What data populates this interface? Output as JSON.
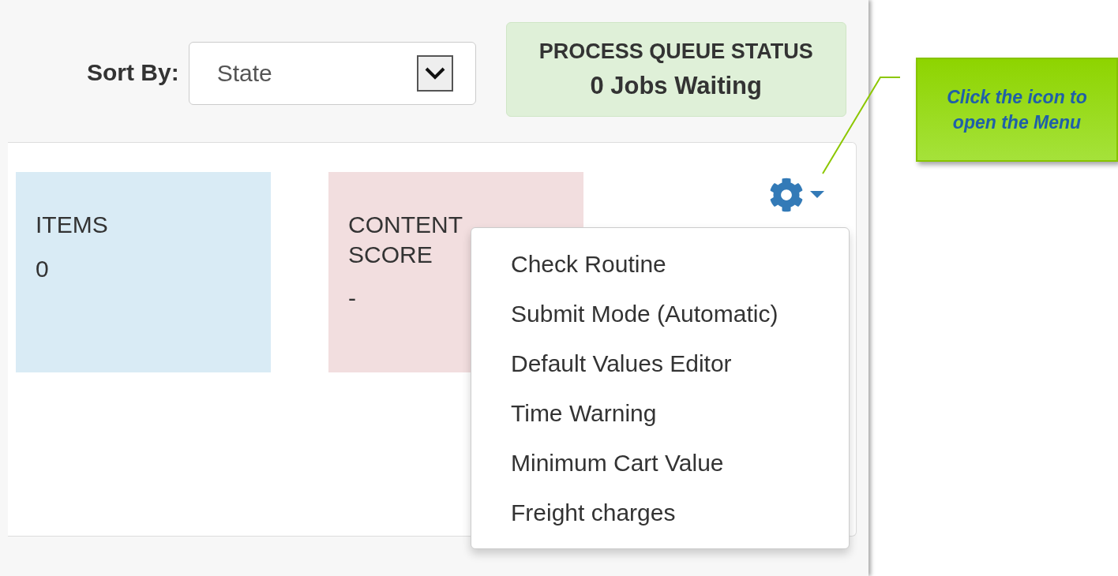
{
  "sort_by": {
    "label": "Sort By:",
    "value": "State"
  },
  "queue_status": {
    "title": "PROCESS QUEUE STATUS",
    "value": "0 Jobs Waiting"
  },
  "cards": [
    {
      "title": "ITEMS",
      "value": "0",
      "color": "#d9ebf5"
    },
    {
      "title": "CONTENT SCORE",
      "value": "-",
      "color": "#f2dedf"
    }
  ],
  "settings_menu": {
    "expanded": true,
    "items": [
      "Check Routine",
      "Submit Mode (Automatic)",
      "Default Values Editor",
      "Time Warning",
      "Minimum Cart Value",
      "Freight charges"
    ]
  },
  "callout": {
    "text": "Click the icon to open the Menu"
  }
}
